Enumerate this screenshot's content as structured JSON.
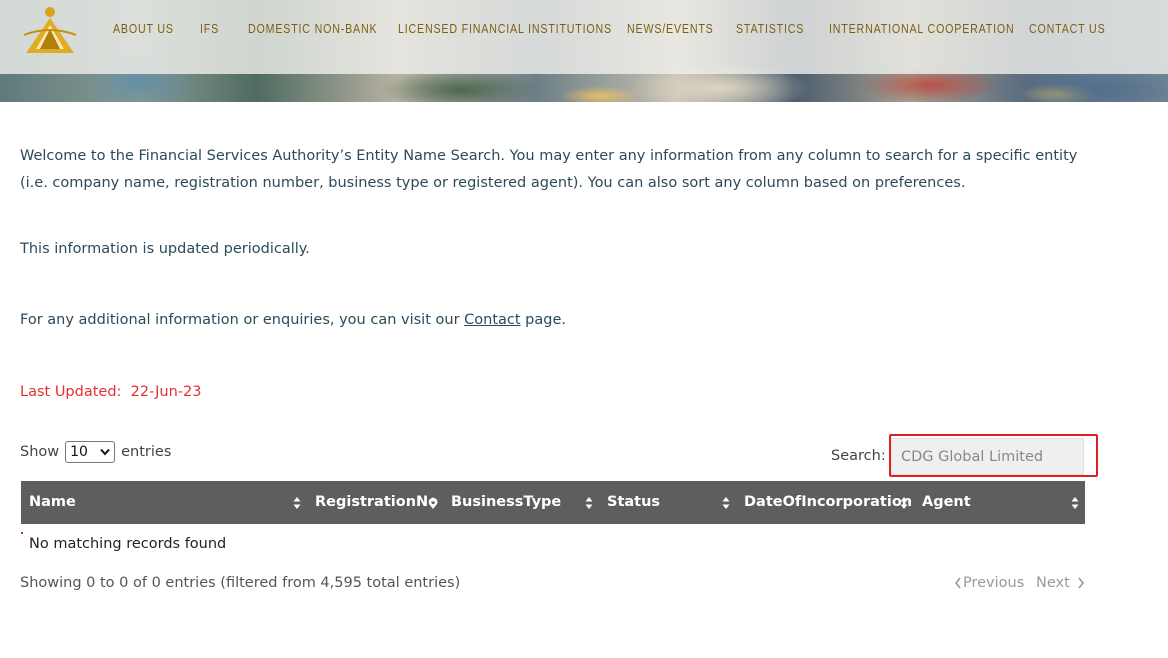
{
  "nav": {
    "items": [
      {
        "label": "ABOUT US"
      },
      {
        "label": "IFS"
      },
      {
        "label": "DOMESTIC NON-BANK"
      },
      {
        "label": "LICENSED FINANCIAL INSTITUTIONS"
      },
      {
        "label": "NEWS/EVENTS"
      },
      {
        "label": "STATISTICS"
      },
      {
        "label": "INTERNATIONAL COOPERATION"
      },
      {
        "label": "CONTACT US"
      }
    ]
  },
  "intro": {
    "text": "Welcome to the Financial Services Authority’s Entity Name Search. You may enter any information from any column to search for a specific entity (i.e. company name, registration number, business type or registered agent). You can also sort any column based on preferences.",
    "periodic": "This information is updated periodically.",
    "contact_prefix": "For any additional information or enquiries, you can visit our ",
    "contact_link": "Contact",
    "contact_suffix": " page.",
    "last_updated_label": "Last Updated:",
    "last_updated_value": "22-Jun-23"
  },
  "controls": {
    "show_label": "Show",
    "entries_value": "10",
    "entries_label": "entries",
    "search_label": "Search:",
    "search_value": "CDG Global Limited"
  },
  "table": {
    "columns": [
      {
        "label": "Name"
      },
      {
        "label": "RegistrationNo"
      },
      {
        "label": "BusinessType"
      },
      {
        "label": "Status"
      },
      {
        "label": "DateOfIncorporation"
      },
      {
        "label": "Agent"
      }
    ],
    "empty_message": "No matching records found"
  },
  "footer": {
    "info": "Showing 0 to 0 of 0 entries (filtered from 4,595 total entries)",
    "previous": "Previous",
    "next": "Next"
  },
  "colors": {
    "accent_gold": "#7d5e12",
    "header_bg": "#5e5e5e",
    "highlight_red": "#e02020"
  }
}
